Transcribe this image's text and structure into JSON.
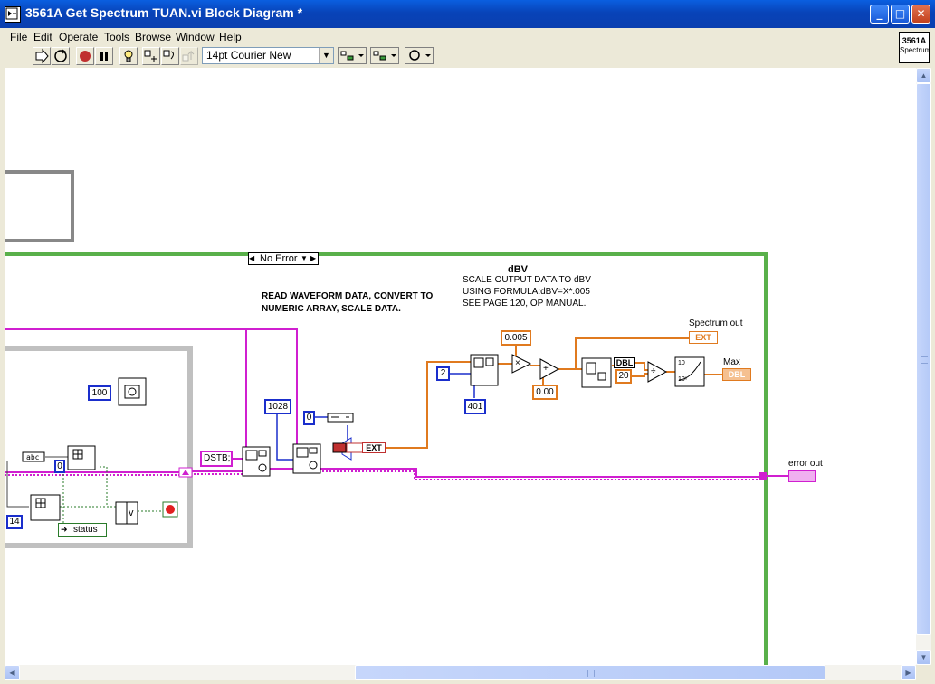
{
  "window": {
    "title": "3561A Get Spectrum TUAN.vi Block Diagram *",
    "minimize_glyph": "_",
    "maximize_glyph": "□",
    "close_glyph": "✕"
  },
  "menu": {
    "file": "File",
    "edit": "Edit",
    "operate": "Operate",
    "tools": "Tools",
    "browse": "Browse",
    "window": "Window",
    "help": "Help"
  },
  "toolbar": {
    "font": "14pt Courier New",
    "help_glyph": "?"
  },
  "vi_icon": {
    "line1": "3561A",
    "line2": "Spectrum"
  },
  "diagram": {
    "case_selector": "No Error",
    "case_dec": "◀",
    "case_inc": "▶",
    "comment_read": "READ WAVEFORM DATA, CONVERT TO\nNUMERIC ARRAY, SCALE DATA.",
    "dbv_title": "dBV",
    "comment_scale": "SCALE OUTPUT DATA TO dBV\nUSING FORMULA:dBV=X*.005\nSEE PAGE 120, OP MANUAL.",
    "spectrum_out": "Spectrum out",
    "spectrum_out_type": "EXT",
    "max": "Max",
    "max_type": "DBL",
    "error_out": "error out",
    "const_100": "100",
    "const_1028": "1028",
    "const_0a": "0",
    "const_0b": "0",
    "const_14": "14",
    "const_2": "2",
    "const_401": "401",
    "const_0005": "0.005",
    "const_000": "0.00",
    "const_20": "20",
    "const_dstb": "DSTB;",
    "status": "status",
    "ext_tag": "EXT",
    "dbl_tag": "DBL",
    "or_glyph": "v",
    "mult_glyph": "×",
    "add_glyph": "+",
    "div_glyph": "÷",
    "log_top": "10",
    "log_bottom": "10ˣ"
  },
  "colors": {
    "integer_wire": "#1a2ecc",
    "double_wire": "#e07a1f",
    "cluster_wire": "#d01fd0",
    "case_border": "#59b04a",
    "loop_border": "#c0c0c0"
  }
}
